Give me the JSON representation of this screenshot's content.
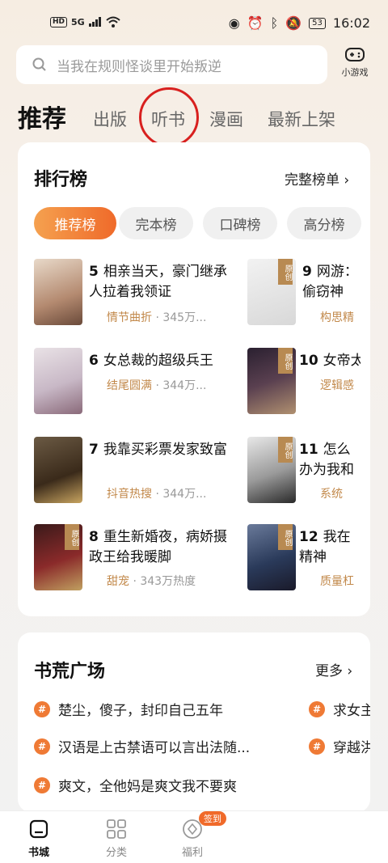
{
  "status_bar": {
    "left_badge": "HD",
    "signal": "5G",
    "time": "16:02",
    "battery": "53"
  },
  "search": {
    "placeholder": "当我在规则怪谈里开始叛逆",
    "icon": "search-icon"
  },
  "mini_game": {
    "label": "小游戏",
    "icon": "gamepad-icon"
  },
  "tabs": [
    {
      "label": "推荐"
    },
    {
      "label": "出版"
    },
    {
      "label": "听书"
    },
    {
      "label": "漫画"
    },
    {
      "label": "最新上架"
    }
  ],
  "ranking": {
    "title": "排行榜",
    "more": "完整榜单",
    "pills": [
      "推荐榜",
      "完本榜",
      "口碑榜",
      "高分榜"
    ],
    "books": [
      {
        "num": "5",
        "title": "相亲当天，豪门继承人拉着我领证",
        "tag": "情节曲折",
        "heat": "345万..."
      },
      {
        "num": "6",
        "title": "女总裁的超级兵王",
        "tag": "结尾圆满",
        "heat": "344万..."
      },
      {
        "num": "7",
        "title": "我靠买彩票发家致富",
        "tag": "抖音热搜",
        "heat": "344万..."
      },
      {
        "num": "8",
        "title": "重生新婚夜，病娇摄政王给我暖脚",
        "tag": "甜宠",
        "heat": "343万热度"
      },
      {
        "num": "9",
        "title": "网游：偷窃神",
        "tag": "构思精",
        "heat": ""
      },
      {
        "num": "10",
        "title": "女帝太",
        "tag": "逻辑感",
        "heat": ""
      },
      {
        "num": "11",
        "title": "怎么办为我和",
        "tag": "系统",
        "heat": ""
      },
      {
        "num": "12",
        "title": "我在精神",
        "tag": "质量杠",
        "heat": ""
      }
    ],
    "ribbon": "原创"
  },
  "plaza": {
    "title": "书荒广场",
    "more": "更多",
    "items": [
      "楚尘，傻子，封印自己五年",
      "汉语是上古禁语可以言出法随...",
      "爽文，全他妈是爽文我不要爽",
      "求女主",
      "穿越洪"
    ]
  },
  "bottom_nav": [
    {
      "label": "书城"
    },
    {
      "label": "分类"
    },
    {
      "label": "福利"
    }
  ],
  "badge": "签到",
  "colors": {
    "accent": "#ef6a2a",
    "tag": "#c2894b",
    "highlight_circle": "#d8201f"
  }
}
